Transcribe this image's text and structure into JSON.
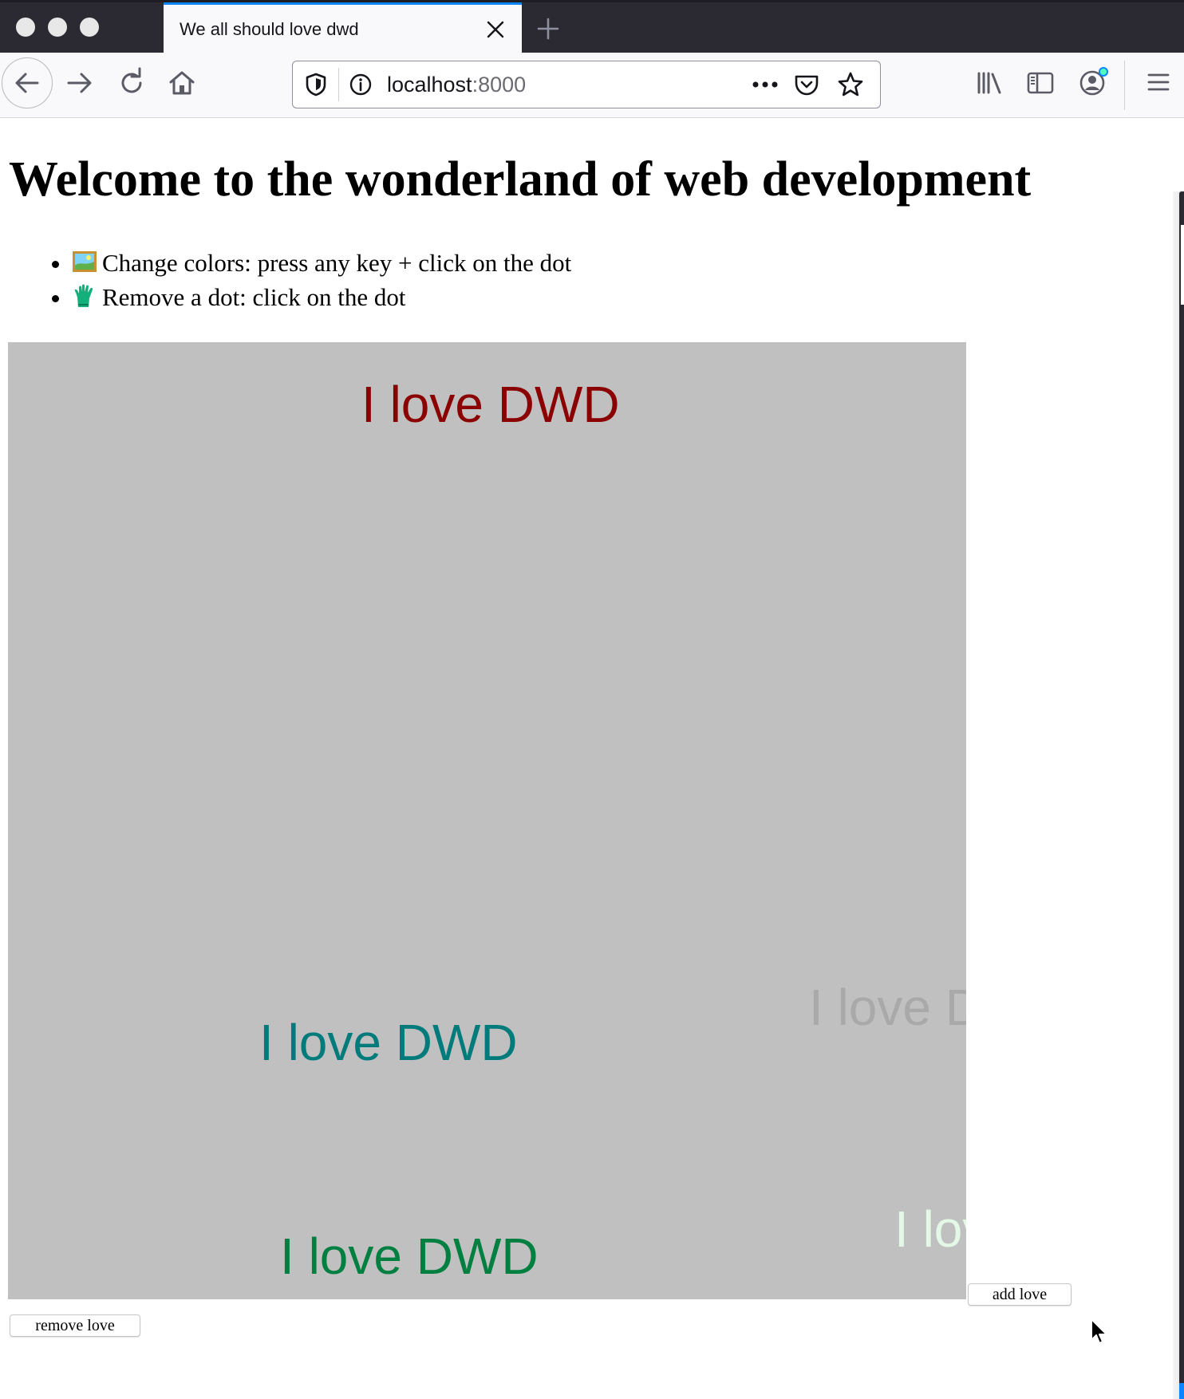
{
  "browser": {
    "tab_title": "We all should love dwd",
    "url_host": "localhost",
    "url_port": ":8000"
  },
  "icons": {
    "back": "arrow-left-icon",
    "forward": "arrow-right-icon",
    "reload": "reload-icon",
    "home": "home-icon",
    "shield": "shield-icon",
    "info": "info-icon",
    "more": "more-dots-icon",
    "pocket": "pocket-icon",
    "bookmark": "star-icon",
    "library": "library-icon",
    "sidebar": "sidebar-icon",
    "account": "account-icon",
    "menu": "hamburger-menu-icon"
  },
  "page": {
    "heading": "Welcome to the wonderland of web development",
    "instructions": [
      {
        "icon": "framed-picture-icon",
        "text": "Change colors: press any key + click on the dot"
      },
      {
        "icon": "glove-icon",
        "text": "Remove a dot: click on the dot"
      }
    ],
    "canvas_background": "#c0c0c0",
    "love_labels": [
      {
        "text": "I love DWD",
        "color": "#8b0000"
      },
      {
        "text": "I love DWD",
        "color": "#007b7b"
      },
      {
        "text": "I love DWD",
        "color": "#a9a9a9"
      },
      {
        "text": "I love DWD",
        "color": "#008040"
      },
      {
        "text": "I love DWD",
        "color": "#e4f8e8"
      }
    ],
    "add_button": "add love",
    "remove_button": "remove love"
  },
  "colors": {
    "tab_accent": "#0a84ff",
    "chrome_dark": "#2b2a33"
  }
}
